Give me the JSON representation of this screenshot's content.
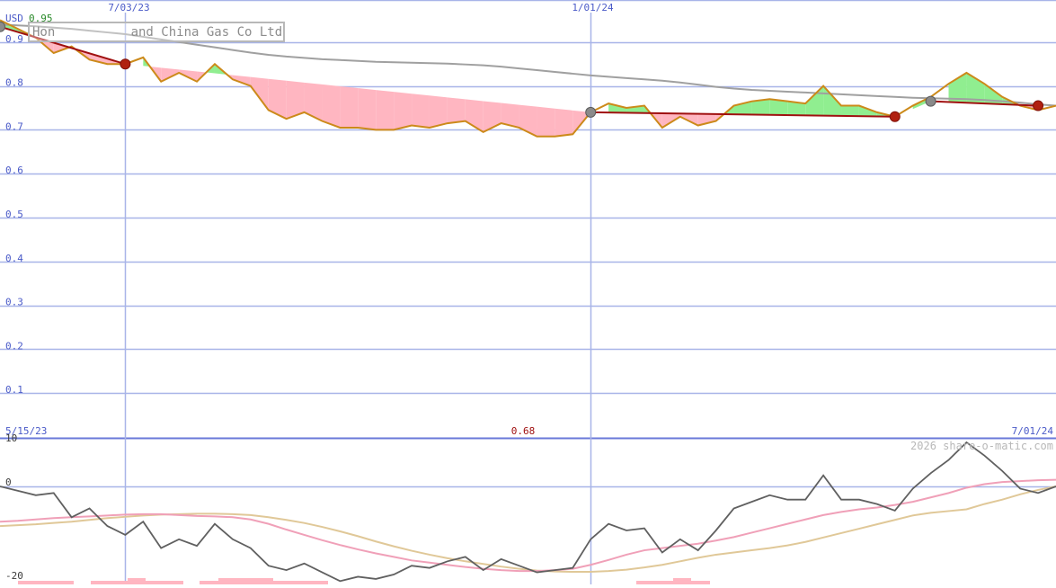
{
  "title": "Hon          and China Gas Co Ltd",
  "currency": "USD",
  "price_max_label": "0.95",
  "period_start": "5/15/23",
  "period_end": "7/01/24",
  "period_low_label": "0.68",
  "watermark": "2026 share-o-matic.com",
  "colors": {
    "price": "#cc8a1a",
    "ma_long": "#a0a0a0",
    "up_fill": "#90ee90",
    "down_fill": "#ffb6c1",
    "trend": "#a01010",
    "grid": "#a8b4e8",
    "axis_text": "#4a5ac8",
    "osc": "#606060",
    "osc_fast": "#f0a0b8",
    "osc_slow": "#e0c898"
  },
  "chart_data": [
    {
      "type": "line",
      "name": "price-panel",
      "ylim": [
        0,
        0.95
      ],
      "yticks": [
        "0.1",
        "0.2",
        "0.3",
        "0.4",
        "0.5",
        "0.6",
        "0.7",
        "0.8",
        "0.9"
      ],
      "xticks": [
        "7/03/23",
        "1/01/24"
      ],
      "x": [
        "2023-05-15",
        "2023-05-22",
        "2023-05-29",
        "2023-06-05",
        "2023-06-12",
        "2023-06-19",
        "2023-06-26",
        "2023-07-03",
        "2023-07-10",
        "2023-07-17",
        "2023-07-24",
        "2023-07-31",
        "2023-08-07",
        "2023-08-14",
        "2023-08-21",
        "2023-08-28",
        "2023-09-04",
        "2023-09-11",
        "2023-09-18",
        "2023-09-25",
        "2023-10-02",
        "2023-10-09",
        "2023-10-16",
        "2023-10-23",
        "2023-10-30",
        "2023-11-06",
        "2023-11-13",
        "2023-11-20",
        "2023-11-27",
        "2023-12-04",
        "2023-12-11",
        "2023-12-18",
        "2023-12-25",
        "2024-01-01",
        "2024-01-08",
        "2024-01-15",
        "2024-01-22",
        "2024-01-29",
        "2024-02-05",
        "2024-02-12",
        "2024-02-19",
        "2024-02-26",
        "2024-03-04",
        "2024-03-11",
        "2024-03-18",
        "2024-03-25",
        "2024-04-01",
        "2024-04-08",
        "2024-04-15",
        "2024-04-22",
        "2024-04-29",
        "2024-05-06",
        "2024-05-13",
        "2024-05-20",
        "2024-05-27",
        "2024-06-03",
        "2024-06-10",
        "2024-06-17",
        "2024-06-24",
        "2024-07-01"
      ],
      "series": [
        {
          "role": "price",
          "values": [
            0.95,
            0.93,
            0.91,
            0.875,
            0.89,
            0.86,
            0.85,
            0.85,
            0.865,
            0.81,
            0.83,
            0.81,
            0.85,
            0.815,
            0.8,
            0.745,
            0.725,
            0.74,
            0.72,
            0.705,
            0.705,
            0.7,
            0.7,
            0.71,
            0.705,
            0.715,
            0.72,
            0.695,
            0.715,
            0.705,
            0.685,
            0.685,
            0.69,
            0.74,
            0.76,
            0.75,
            0.755,
            0.705,
            0.73,
            0.71,
            0.72,
            0.755,
            0.765,
            0.77,
            0.765,
            0.76,
            0.8,
            0.755,
            0.755,
            0.74,
            0.73,
            0.755,
            0.775,
            0.805,
            0.83,
            0.805,
            0.775,
            0.755,
            0.745,
            0.755
          ]
        },
        {
          "role": "ma_long",
          "values": [
            0.94,
            0.938,
            0.936,
            0.933,
            0.93,
            0.926,
            0.922,
            0.918,
            0.912,
            0.906,
            0.9,
            0.894,
            0.888,
            0.882,
            0.876,
            0.871,
            0.867,
            0.864,
            0.861,
            0.859,
            0.857,
            0.855,
            0.854,
            0.853,
            0.852,
            0.851,
            0.849,
            0.847,
            0.844,
            0.84,
            0.836,
            0.832,
            0.828,
            0.824,
            0.821,
            0.818,
            0.815,
            0.812,
            0.808,
            0.803,
            0.798,
            0.794,
            0.791,
            0.789,
            0.787,
            0.785,
            0.783,
            0.781,
            0.779,
            0.777,
            0.775,
            0.773,
            0.772,
            0.771,
            0.77,
            0.768,
            0.765,
            0.762,
            0.758,
            0.755
          ]
        }
      ],
      "trend_points": [
        {
          "x": "2023-05-15",
          "y": 0.935,
          "kind": "peak"
        },
        {
          "x": "2023-07-03",
          "y": 0.85,
          "kind": "trough"
        },
        {
          "x": "2024-01-01",
          "y": 0.74,
          "kind": "peak"
        },
        {
          "x": "2024-04-29",
          "y": 0.73,
          "kind": "trough"
        },
        {
          "x": "2024-05-13",
          "y": 0.765,
          "kind": "peak"
        },
        {
          "x": "2024-06-24",
          "y": 0.755,
          "kind": "trough"
        }
      ]
    },
    {
      "type": "line",
      "name": "oscillator-panel",
      "ylim": [
        -20,
        10
      ],
      "yticks": [
        "10",
        "0",
        "-20"
      ],
      "series": [
        {
          "role": "oscillator",
          "values": [
            0,
            -1,
            -2,
            -1.5,
            -7,
            -5,
            -9,
            -11,
            -8,
            -14,
            -12,
            -13.5,
            -8.5,
            -12,
            -14,
            -18,
            -19,
            -17.5,
            -19.5,
            -21.5,
            -20.5,
            -21,
            -20,
            -18,
            -18.5,
            -17,
            -16,
            -19,
            -16.5,
            -18,
            -19.5,
            -19,
            -18.5,
            -12,
            -8.5,
            -10,
            -9.5,
            -15,
            -12,
            -14.5,
            -10,
            -5,
            -3.5,
            -2,
            -3,
            -3,
            2.5,
            -3,
            -3,
            -4,
            -5.5,
            -0.5,
            3,
            6,
            10,
            7,
            3.5,
            -0.5,
            -1.5,
            0
          ]
        },
        {
          "role": "fast_signal",
          "values": [
            -8,
            -7.8,
            -7.5,
            -7.2,
            -7,
            -6.8,
            -6.6,
            -6.4,
            -6.3,
            -6.3,
            -6.5,
            -6.7,
            -6.8,
            -7,
            -7.5,
            -8.5,
            -9.8,
            -11,
            -12.2,
            -13.3,
            -14.3,
            -15.2,
            -16,
            -16.8,
            -17.3,
            -17.8,
            -18.3,
            -18.7,
            -19,
            -19.2,
            -19.2,
            -19,
            -18.7,
            -17.8,
            -16.7,
            -15.5,
            -14.5,
            -14,
            -13.5,
            -13,
            -12.3,
            -11.5,
            -10.5,
            -9.5,
            -8.5,
            -7.5,
            -6.5,
            -5.8,
            -5.2,
            -4.8,
            -4.2,
            -3.5,
            -2.5,
            -1.5,
            -0.3,
            0.5,
            1,
            1.2,
            1.4,
            1.5
          ]
        },
        {
          "role": "slow_signal",
          "values": [
            -9,
            -8.8,
            -8.6,
            -8.3,
            -8,
            -7.6,
            -7.2,
            -6.9,
            -6.6,
            -6.4,
            -6.3,
            -6.2,
            -6.2,
            -6.3,
            -6.5,
            -7,
            -7.6,
            -8.3,
            -9.2,
            -10.2,
            -11.3,
            -12.5,
            -13.6,
            -14.6,
            -15.5,
            -16.3,
            -17,
            -17.6,
            -18.2,
            -18.7,
            -19.1,
            -19.3,
            -19.4,
            -19.4,
            -19.2,
            -18.9,
            -18.4,
            -17.8,
            -17,
            -16.2,
            -15.5,
            -15,
            -14.5,
            -14,
            -13.4,
            -12.6,
            -11.6,
            -10.6,
            -9.6,
            -8.6,
            -7.6,
            -6.6,
            -6,
            -5.6,
            -5.2,
            -4,
            -3,
            -1.8,
            -0.8,
            0
          ]
        }
      ]
    }
  ]
}
